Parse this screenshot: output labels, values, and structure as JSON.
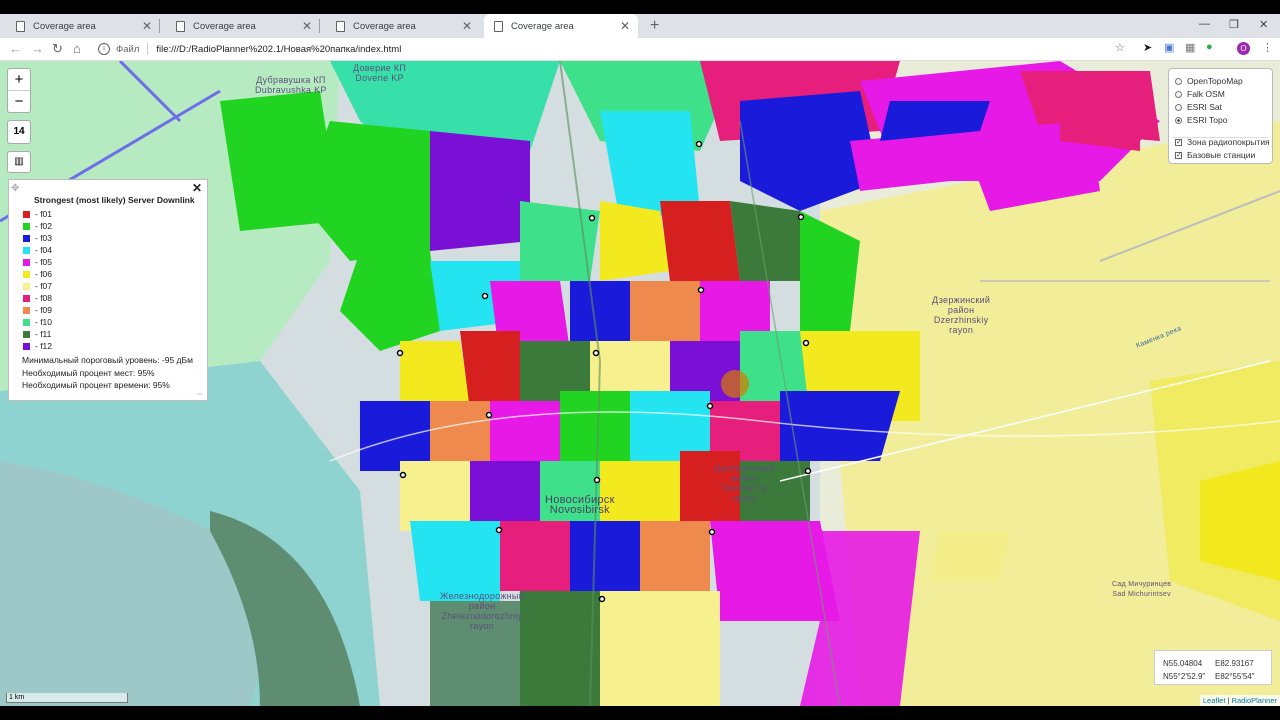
{
  "browser": {
    "tabs": [
      {
        "title": "Coverage area"
      },
      {
        "title": "Coverage area"
      },
      {
        "title": "Coverage area"
      },
      {
        "title": "Coverage area"
      }
    ],
    "address": {
      "scheme_label": "Файл",
      "url": "file:///D:/RadioPlanner%202.1/Новая%20папка/index.html"
    },
    "profile_initial": "O"
  },
  "map": {
    "zoom_level": "14",
    "labels": {
      "doverie": "Доверие КП\nDoverie KP",
      "dubravushka": "Дубравушка КП\nDubravushka KP",
      "novosibirsk": "Новосибирск\nNovosibirsk",
      "tsentralny": "Центральный\nрайон\nTsentral'ny\nrayon",
      "dzerzhinsky": "Дзержинский\nрайон\nDzerzhinskiy\nrayon",
      "zheleznodorozhny": "Железнодорожный\nрайон\nZheleznodorozhniy\nrayon",
      "sad_michurintsev": "Сад Мичуринцев\nSad Michurintsev",
      "kamenka": "Каменка река"
    },
    "scale_label": "1 km",
    "attribution": {
      "leaflet": "Leaflet",
      "separator": " | ",
      "provider": "RadioPlanner"
    }
  },
  "legend": {
    "title": "Strongest (most likely) Server Downlink",
    "items": [
      {
        "label": "- f01",
        "color": "#d61f1f"
      },
      {
        "label": "- f02",
        "color": "#22d422"
      },
      {
        "label": "- f03",
        "color": "#1a1adb"
      },
      {
        "label": "- f04",
        "color": "#23e4f0"
      },
      {
        "label": "- f05",
        "color": "#e619e6"
      },
      {
        "label": "- f06",
        "color": "#f2ea1f"
      },
      {
        "label": "- f07",
        "color": "#f7f08f"
      },
      {
        "label": "- f08",
        "color": "#e61e7c"
      },
      {
        "label": "- f09",
        "color": "#ef8a4f"
      },
      {
        "label": "- f10",
        "color": "#3fe08a"
      },
      {
        "label": "- f11",
        "color": "#3c7a3c"
      },
      {
        "label": "- f12",
        "color": "#7a10d6"
      }
    ],
    "notes": [
      "Минимальный пороговый уровень: -95 дБм",
      "Необходимый процент мест: 95%",
      "Необходимый процент времени: 95%"
    ]
  },
  "layers": {
    "basemaps": [
      {
        "label": "OpenTopoMap",
        "selected": false
      },
      {
        "label": "Falk OSM",
        "selected": false
      },
      {
        "label": "ESRI Sat",
        "selected": false
      },
      {
        "label": "ESRI Topo",
        "selected": true
      }
    ],
    "overlays": [
      {
        "label": "Зона радиопокрытия",
        "checked": true
      },
      {
        "label": "Базовые станции",
        "checked": true
      }
    ]
  },
  "coordinates": {
    "lat_decimal": "N55.04804",
    "lon_decimal": "E82.93167",
    "lat_dms": "N55°2'52.9\"",
    "lon_dms": "E82°55'54\""
  }
}
